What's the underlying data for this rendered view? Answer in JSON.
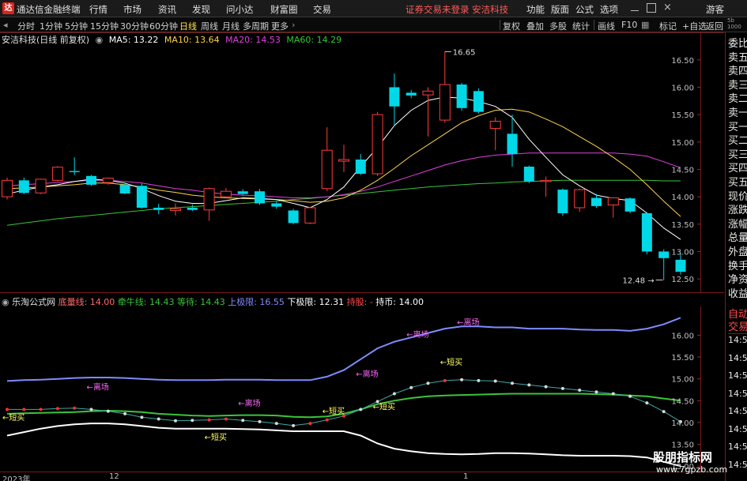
{
  "window": {
    "app_name": "通达信金融终端",
    "menus": [
      "行情",
      "市场",
      "资讯",
      "发现",
      "问小达",
      "财富圈",
      "交易"
    ],
    "notice": "证券交易未登录  安洁科技",
    "right_menus": [
      "功能",
      "版面",
      "公式",
      "选项"
    ],
    "user": "游客"
  },
  "toolbar": {
    "periods": [
      "分时",
      "1分钟",
      "5分钟",
      "15分钟",
      "30分钟",
      "60分钟",
      "日线",
      "周线",
      "月线",
      "多周期",
      "更多"
    ],
    "active_period": "日线",
    "tools": [
      "复权",
      "叠加",
      "多股",
      "统计",
      "画线",
      "F10",
      "标记",
      "+自选",
      "返回"
    ]
  },
  "main_chart": {
    "stock_label": "安洁科技(日线 前复权)",
    "ma_legend": [
      {
        "label": "MA5: 13.22",
        "color": "#ffffff"
      },
      {
        "label": "MA10: 13.64",
        "color": "#ffd24a"
      },
      {
        "label": "MA20: 14.53",
        "color": "#e040e0"
      },
      {
        "label": "MA60: 14.29",
        "color": "#3ac43a"
      }
    ],
    "price_ticks": [
      "16.50",
      "16.00",
      "15.50",
      "15.00",
      "14.50",
      "14.00",
      "13.50",
      "13.00",
      "12.50"
    ],
    "high_label": "16.65",
    "low_label": "12.48"
  },
  "chart_data": {
    "type": "candlestick",
    "ylim": [
      12.3,
      16.8
    ],
    "candles": [
      {
        "o": 14.0,
        "h": 14.35,
        "l": 13.95,
        "c": 14.3
      },
      {
        "o": 14.3,
        "h": 14.35,
        "l": 14.05,
        "c": 14.07
      },
      {
        "o": 14.07,
        "h": 14.33,
        "l": 14.05,
        "c": 14.32
      },
      {
        "o": 14.3,
        "h": 14.56,
        "l": 14.28,
        "c": 14.54
      },
      {
        "o": 14.47,
        "h": 14.72,
        "l": 14.4,
        "c": 14.45
      },
      {
        "o": 14.38,
        "h": 14.4,
        "l": 14.2,
        "c": 14.22
      },
      {
        "o": 14.26,
        "h": 14.35,
        "l": 14.22,
        "c": 14.34
      },
      {
        "o": 14.22,
        "h": 14.26,
        "l": 14.05,
        "c": 14.06
      },
      {
        "o": 14.2,
        "h": 14.24,
        "l": 13.78,
        "c": 13.8
      },
      {
        "o": 13.8,
        "h": 13.87,
        "l": 13.68,
        "c": 13.76
      },
      {
        "o": 13.75,
        "h": 13.88,
        "l": 13.66,
        "c": 13.78
      },
      {
        "o": 13.8,
        "h": 13.86,
        "l": 13.74,
        "c": 13.76
      },
      {
        "o": 13.76,
        "h": 14.17,
        "l": 13.56,
        "c": 14.15
      },
      {
        "o": 14.0,
        "h": 14.16,
        "l": 13.98,
        "c": 14.1
      },
      {
        "o": 14.1,
        "h": 14.14,
        "l": 14.02,
        "c": 14.05
      },
      {
        "o": 14.1,
        "h": 14.14,
        "l": 13.85,
        "c": 13.88
      },
      {
        "o": 13.88,
        "h": 13.92,
        "l": 13.78,
        "c": 13.82
      },
      {
        "o": 13.75,
        "h": 13.78,
        "l": 13.5,
        "c": 13.52
      },
      {
        "o": 13.52,
        "h": 13.82,
        "l": 13.5,
        "c": 13.8
      },
      {
        "o": 14.15,
        "h": 15.27,
        "l": 14.1,
        "c": 14.85
      },
      {
        "o": 14.65,
        "h": 14.95,
        "l": 14.45,
        "c": 14.68
      },
      {
        "o": 14.68,
        "h": 14.78,
        "l": 14.4,
        "c": 14.42
      },
      {
        "o": 14.42,
        "h": 15.55,
        "l": 14.38,
        "c": 15.5
      },
      {
        "o": 16.0,
        "h": 16.25,
        "l": 15.3,
        "c": 15.65
      },
      {
        "o": 15.9,
        "h": 15.95,
        "l": 15.8,
        "c": 15.85
      },
      {
        "o": 15.86,
        "h": 16.0,
        "l": 15.1,
        "c": 15.93
      },
      {
        "o": 15.4,
        "h": 16.65,
        "l": 15.35,
        "c": 16.05
      },
      {
        "o": 16.05,
        "h": 16.08,
        "l": 15.57,
        "c": 15.62
      },
      {
        "o": 15.93,
        "h": 15.98,
        "l": 15.52,
        "c": 15.55
      },
      {
        "o": 15.25,
        "h": 15.45,
        "l": 14.85,
        "c": 15.38
      },
      {
        "o": 15.15,
        "h": 15.5,
        "l": 14.55,
        "c": 14.78
      },
      {
        "o": 14.55,
        "h": 14.57,
        "l": 14.25,
        "c": 14.28
      },
      {
        "o": 14.28,
        "h": 14.37,
        "l": 14.0,
        "c": 14.3
      },
      {
        "o": 14.13,
        "h": 14.15,
        "l": 13.65,
        "c": 13.7
      },
      {
        "o": 13.8,
        "h": 14.15,
        "l": 13.72,
        "c": 14.13
      },
      {
        "o": 13.98,
        "h": 14.05,
        "l": 13.8,
        "c": 13.83
      },
      {
        "o": 13.85,
        "h": 13.98,
        "l": 13.62,
        "c": 13.98
      },
      {
        "o": 13.97,
        "h": 13.99,
        "l": 13.7,
        "c": 13.73
      },
      {
        "o": 13.7,
        "h": 13.72,
        "l": 12.95,
        "c": 13.0
      },
      {
        "o": 13.0,
        "h": 13.04,
        "l": 12.48,
        "c": 12.88
      },
      {
        "o": 12.85,
        "h": 12.98,
        "l": 12.58,
        "c": 12.63
      }
    ],
    "ma5": [
      14.05,
      14.12,
      14.18,
      14.22,
      14.28,
      14.32,
      14.3,
      14.25,
      14.15,
      14.02,
      13.92,
      13.88,
      13.88,
      13.93,
      13.98,
      13.97,
      13.95,
      13.88,
      13.8,
      13.95,
      14.18,
      14.55,
      14.9,
      15.3,
      15.58,
      15.76,
      15.82,
      15.8,
      15.74,
      15.65,
      15.45,
      15.05,
      14.72,
      14.4,
      14.2,
      14.03,
      13.97,
      13.93,
      13.7,
      13.43,
      13.22
    ],
    "ma10": [
      14.15,
      14.16,
      14.18,
      14.2,
      14.22,
      14.25,
      14.25,
      14.22,
      14.18,
      14.12,
      14.08,
      14.03,
      14.0,
      13.98,
      13.97,
      13.96,
      13.95,
      13.93,
      13.9,
      13.92,
      13.98,
      14.12,
      14.3,
      14.52,
      14.75,
      14.95,
      15.15,
      15.35,
      15.48,
      15.58,
      15.6,
      15.55,
      15.42,
      15.28,
      15.1,
      14.92,
      14.72,
      14.5,
      14.22,
      13.92,
      13.64
    ],
    "ma20": [
      14.2,
      14.22,
      14.24,
      14.26,
      14.28,
      14.3,
      14.3,
      14.28,
      14.25,
      14.2,
      14.15,
      14.12,
      14.08,
      14.05,
      14.03,
      14.02,
      14.0,
      13.98,
      13.98,
      14.0,
      14.04,
      14.1,
      14.18,
      14.28,
      14.38,
      14.48,
      14.58,
      14.66,
      14.72,
      14.76,
      14.78,
      14.8,
      14.8,
      14.8,
      14.8,
      14.8,
      14.8,
      14.78,
      14.74,
      14.64,
      14.53
    ],
    "ma60": [
      13.48,
      13.52,
      13.56,
      13.6,
      13.63,
      13.66,
      13.69,
      13.72,
      13.75,
      13.78,
      13.8,
      13.82,
      13.84,
      13.86,
      13.88,
      13.9,
      13.92,
      13.95,
      13.97,
      14.0,
      14.03,
      14.06,
      14.09,
      14.12,
      14.15,
      14.18,
      14.2,
      14.22,
      14.24,
      14.25,
      14.27,
      14.28,
      14.29,
      14.3,
      14.3,
      14.3,
      14.3,
      14.3,
      14.3,
      14.29,
      14.29
    ]
  },
  "sub_chart": {
    "name": "乐淘公式网",
    "legend": [
      {
        "label": "底量线: 14.00",
        "color": "#ff4a4a"
      },
      {
        "label": "牵牛线: 14.43",
        "color": "#3ac43a"
      },
      {
        "label": "等待: 14.43",
        "color": "#3ac43a"
      },
      {
        "label": "上极限: 16.55",
        "color": "#7e8cff"
      },
      {
        "label": "下极限: 12.31",
        "color": "#ffffff"
      },
      {
        "label": "持股: -",
        "color": "#ff4a4a"
      },
      {
        "label": "持币: 14.00",
        "color": "#ffffff"
      }
    ],
    "ticks": [
      "16.00",
      "15.50",
      "15.00",
      "14.50",
      "14.00",
      "13.50",
      "13.00"
    ],
    "ylim": [
      12.95,
      16.55
    ],
    "upper": [
      14.95,
      14.97,
      14.98,
      15.0,
      15.02,
      15.03,
      15.03,
      15.02,
      15.0,
      14.98,
      14.97,
      14.97,
      14.97,
      14.98,
      14.98,
      14.98,
      14.97,
      14.97,
      14.97,
      15.05,
      15.2,
      15.45,
      15.7,
      15.85,
      15.95,
      16.05,
      16.15,
      16.2,
      16.2,
      16.18,
      16.18,
      16.15,
      16.15,
      16.15,
      16.13,
      16.12,
      16.12,
      16.1,
      16.15,
      16.25,
      16.4
    ],
    "lower": [
      13.7,
      13.78,
      13.86,
      13.92,
      13.96,
      13.98,
      13.98,
      13.96,
      13.92,
      13.88,
      13.86,
      13.86,
      13.86,
      13.86,
      13.85,
      13.84,
      13.82,
      13.8,
      13.8,
      13.8,
      13.8,
      13.7,
      13.52,
      13.4,
      13.34,
      13.3,
      13.28,
      13.27,
      13.28,
      13.3,
      13.3,
      13.29,
      13.27,
      13.25,
      13.24,
      13.24,
      13.24,
      13.23,
      13.2,
      13.1,
      13.0
    ],
    "mid": [
      14.2,
      14.21,
      14.22,
      14.23,
      14.24,
      14.26,
      14.27,
      14.26,
      14.24,
      14.2,
      14.18,
      14.16,
      14.15,
      14.16,
      14.17,
      14.17,
      14.16,
      14.13,
      14.12,
      14.14,
      14.2,
      14.3,
      14.42,
      14.5,
      14.56,
      14.6,
      14.62,
      14.63,
      14.64,
      14.65,
      14.66,
      14.66,
      14.66,
      14.66,
      14.66,
      14.65,
      14.64,
      14.62,
      14.6,
      14.55,
      14.5
    ],
    "dots": [
      14.3,
      14.3,
      14.3,
      14.32,
      14.33,
      14.3,
      14.26,
      14.2,
      14.12,
      14.08,
      14.04,
      14.05,
      14.06,
      14.08,
      14.05,
      14.02,
      13.98,
      13.93,
      13.98,
      14.06,
      14.15,
      14.3,
      14.48,
      14.66,
      14.8,
      14.9,
      14.96,
      14.98,
      14.96,
      14.95,
      14.9,
      14.86,
      14.82,
      14.78,
      14.74,
      14.7,
      14.66,
      14.6,
      14.45,
      14.25,
      14.02
    ],
    "annotations": [
      {
        "text": "←短买",
        "i": 0,
        "y": 14.05,
        "color": "#ffff66"
      },
      {
        "text": "←离场",
        "i": 5,
        "y": 14.75,
        "color": "#ff66ff"
      },
      {
        "text": "←离场",
        "i": 14,
        "y": 14.38,
        "color": "#ff66ff"
      },
      {
        "text": "←短买",
        "i": 12,
        "y": 13.6,
        "color": "#ffff66"
      },
      {
        "text": "←短买",
        "i": 19,
        "y": 14.2,
        "color": "#ffff66"
      },
      {
        "text": "←离场",
        "i": 21,
        "y": 15.05,
        "color": "#ff66ff"
      },
      {
        "text": "←短买",
        "i": 22,
        "y": 14.3,
        "color": "#ffff66"
      },
      {
        "text": "←离场",
        "i": 24,
        "y": 15.95,
        "color": "#ff66ff"
      },
      {
        "text": "←短买",
        "i": 26,
        "y": 15.32,
        "color": "#ffff66"
      },
      {
        "text": "←离场",
        "i": 27,
        "y": 16.23,
        "color": "#ff66ff"
      }
    ]
  },
  "right_panel": {
    "labels": [
      "委比",
      "卖五",
      "卖四",
      "卖三",
      "卖二",
      "卖一",
      "买一",
      "买二",
      "买三",
      "买四",
      "买五",
      "现价",
      "涨跌",
      "涨幅",
      "总量",
      "外盘",
      "换手",
      "净资",
      "收益"
    ],
    "lower_labels": [
      "自动",
      "交易"
    ],
    "times": [
      "14:56",
      "14:56",
      "14:56",
      "14:56",
      "14:56",
      "14:56",
      "14:56",
      "14:56"
    ],
    "corner_top": "5b",
    "corner_bottom": "1000"
  },
  "time_axis": {
    "labels": [
      "2023年",
      "12",
      "1"
    ]
  },
  "watermark": {
    "title": "股朋指标网",
    "url": "www.7gpzb.com"
  },
  "colors": {
    "up": "#ff3b3b",
    "down": "#00d8e8",
    "frame": "#7a1a1a",
    "grid": "#3a0a0a"
  }
}
